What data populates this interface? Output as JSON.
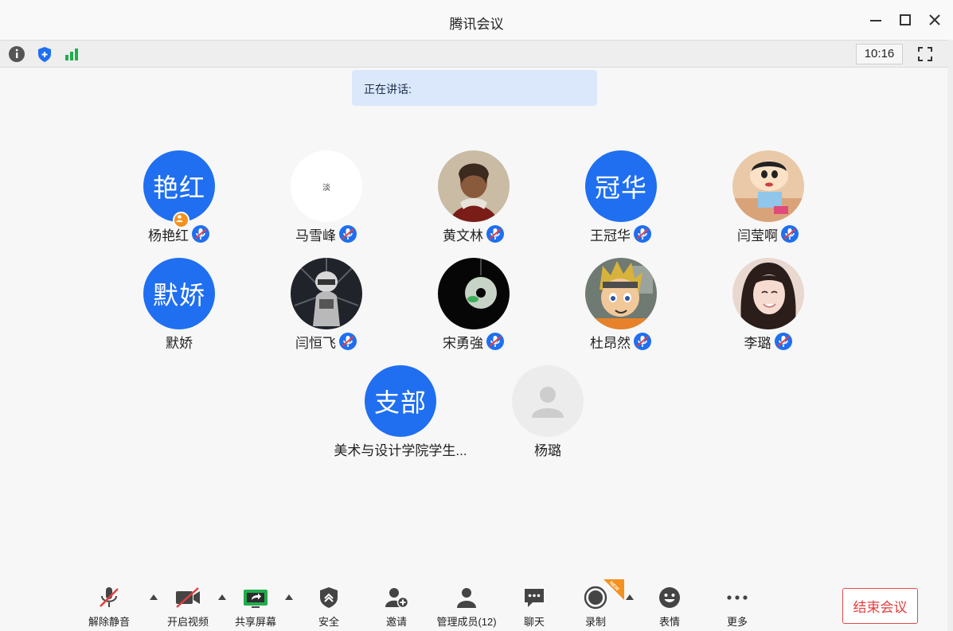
{
  "window": {
    "title": "腾讯会议"
  },
  "toolbar": {
    "time": "10:16"
  },
  "speaking": {
    "label": "正在讲话:"
  },
  "members": [
    {
      "avatar_text": "艳红",
      "name": "杨艳红",
      "muted": true,
      "host": true
    },
    {
      "avatar_text": "淡",
      "name": "马雪峰",
      "muted": true
    },
    {
      "avatar_image": "portrait-girl",
      "name": "黄文林",
      "muted": true
    },
    {
      "avatar_text": "冠华",
      "name": "王冠华",
      "muted": true
    },
    {
      "avatar_image": "cartoon-shinchan",
      "name": "闫莹啊",
      "muted": true
    },
    {
      "avatar_text": "默娇",
      "name": "默娇",
      "muted": false
    },
    {
      "avatar_image": "astronaut",
      "name": "闫恒飞",
      "muted": true
    },
    {
      "avatar_image": "jade-pendant",
      "name": "宋勇強",
      "muted": true
    },
    {
      "avatar_image": "anime-boy",
      "name": "杜昂然",
      "muted": true
    },
    {
      "avatar_image": "smiling-girl",
      "name": "李璐",
      "muted": true
    },
    {
      "avatar_text": "支部",
      "name": "美术与设计学院学生...",
      "muted": false
    },
    {
      "avatar_image": "default-person",
      "name": "杨璐",
      "muted": false
    }
  ],
  "bottom_bar": {
    "unmute": "解除静音",
    "start_video": "开启视频",
    "share_screen": "共享屏幕",
    "security": "安全",
    "invite": "邀请",
    "manage_members": "管理成员(12)",
    "chat": "聊天",
    "record": "录制",
    "record_badge": "NEW",
    "reactions": "表情",
    "more": "更多",
    "end_meeting": "结束会议"
  },
  "colors": {
    "accent": "#1f6ff0",
    "danger": "#e53e3e",
    "host_badge": "#f5911e",
    "speaking_bg": "#dbe8fb"
  }
}
